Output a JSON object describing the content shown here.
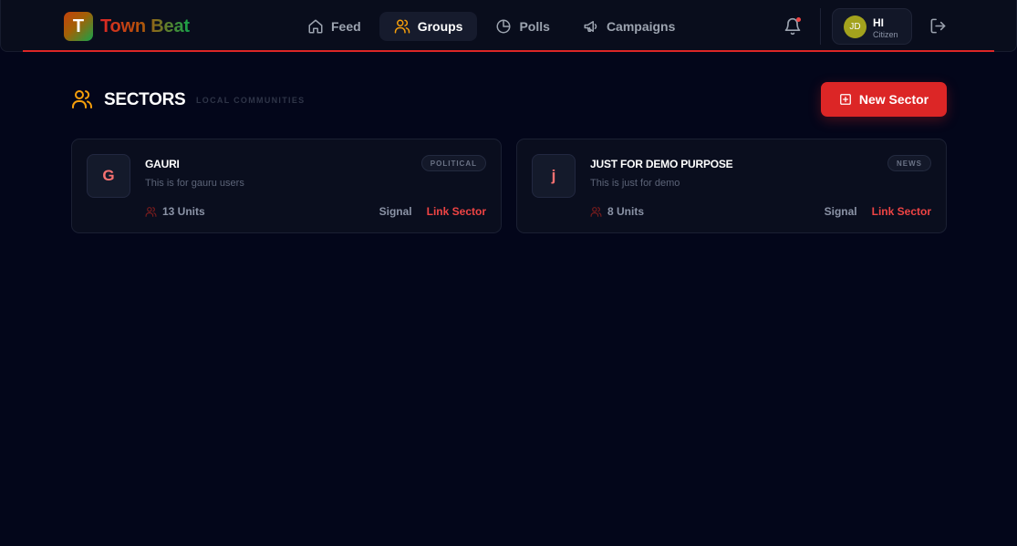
{
  "app": {
    "logo_letter": "T",
    "name": "Town Beat"
  },
  "nav": [
    {
      "label": "Feed",
      "icon": "home-icon"
    },
    {
      "label": "Groups",
      "icon": "users-icon",
      "active": true
    },
    {
      "label": "Polls",
      "icon": "pie-chart-icon"
    },
    {
      "label": "Campaigns",
      "icon": "megaphone-icon"
    }
  ],
  "header": {
    "notification_icon": "bell-icon",
    "user": {
      "initials": "JD",
      "greeting": "HI",
      "role": "Citizen"
    },
    "logout_icon": "logout-icon"
  },
  "section": {
    "icon": "users-icon",
    "title": "SECTORS",
    "subtitle": "LOCAL COMMUNITIES",
    "new_button_label": "New Sector"
  },
  "sectors": [
    {
      "initial": "G",
      "name": "GAURI",
      "description": "This is for gauru users",
      "tag": "POLITICAL",
      "units": "13 Units",
      "signal_label": "Signal",
      "link_label": "Link Sector"
    },
    {
      "initial": "j",
      "name": "JUST FOR DEMO PURPOSE",
      "description": "This is just for demo",
      "tag": "NEWS",
      "units": "8 Units",
      "signal_label": "Signal",
      "link_label": "Link Sector"
    }
  ],
  "colors": {
    "background": "#03061a",
    "accent": "#dc2626",
    "active_icon": "#f59e0b"
  }
}
